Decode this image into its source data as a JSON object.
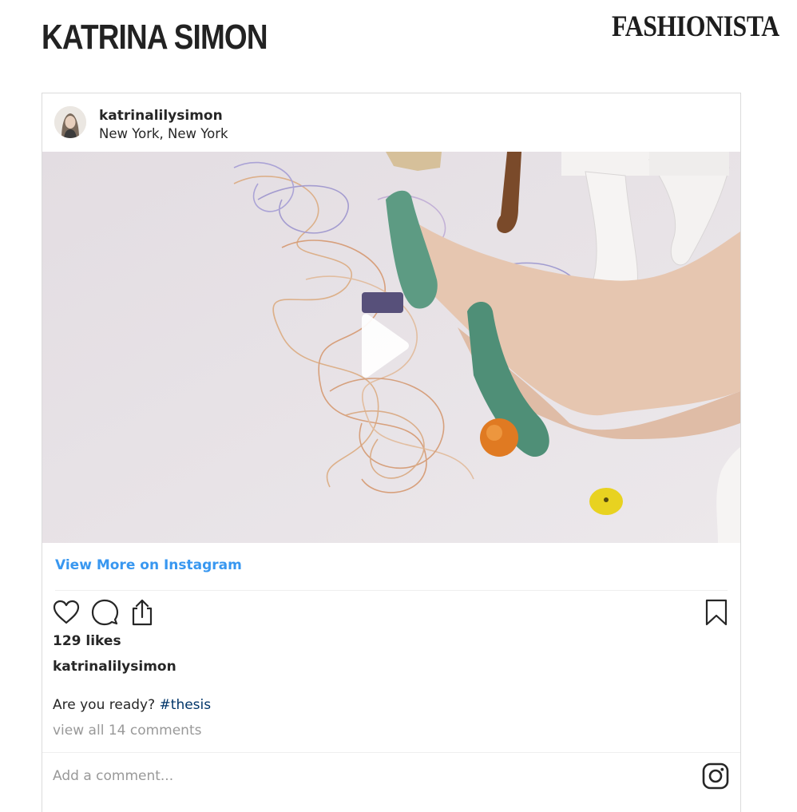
{
  "page": {
    "heading": "KATRINA SIMON",
    "brand": "FASHIONISTA"
  },
  "post": {
    "username": "katrinalilysimon",
    "location": "New York, New York",
    "media_type": "video",
    "view_more_label": "View More on Instagram",
    "likes": "129 likes",
    "caption_user": "katrinalilysimon",
    "caption_text": "Are you ready? ",
    "caption_hashtag": "#thesis",
    "view_comments": "view all 14 comments",
    "comment_placeholder": "Add a comment..."
  },
  "icons": {
    "like": "heart-icon",
    "comment": "speech-bubble-icon",
    "share": "share-icon",
    "save": "bookmark-icon",
    "instagram": "instagram-logo-icon",
    "play": "play-icon"
  },
  "colors": {
    "link_blue": "#3897f0",
    "hashtag": "#003569",
    "muted_text": "#999999",
    "text": "#262626",
    "border": "#dbdbdb"
  }
}
